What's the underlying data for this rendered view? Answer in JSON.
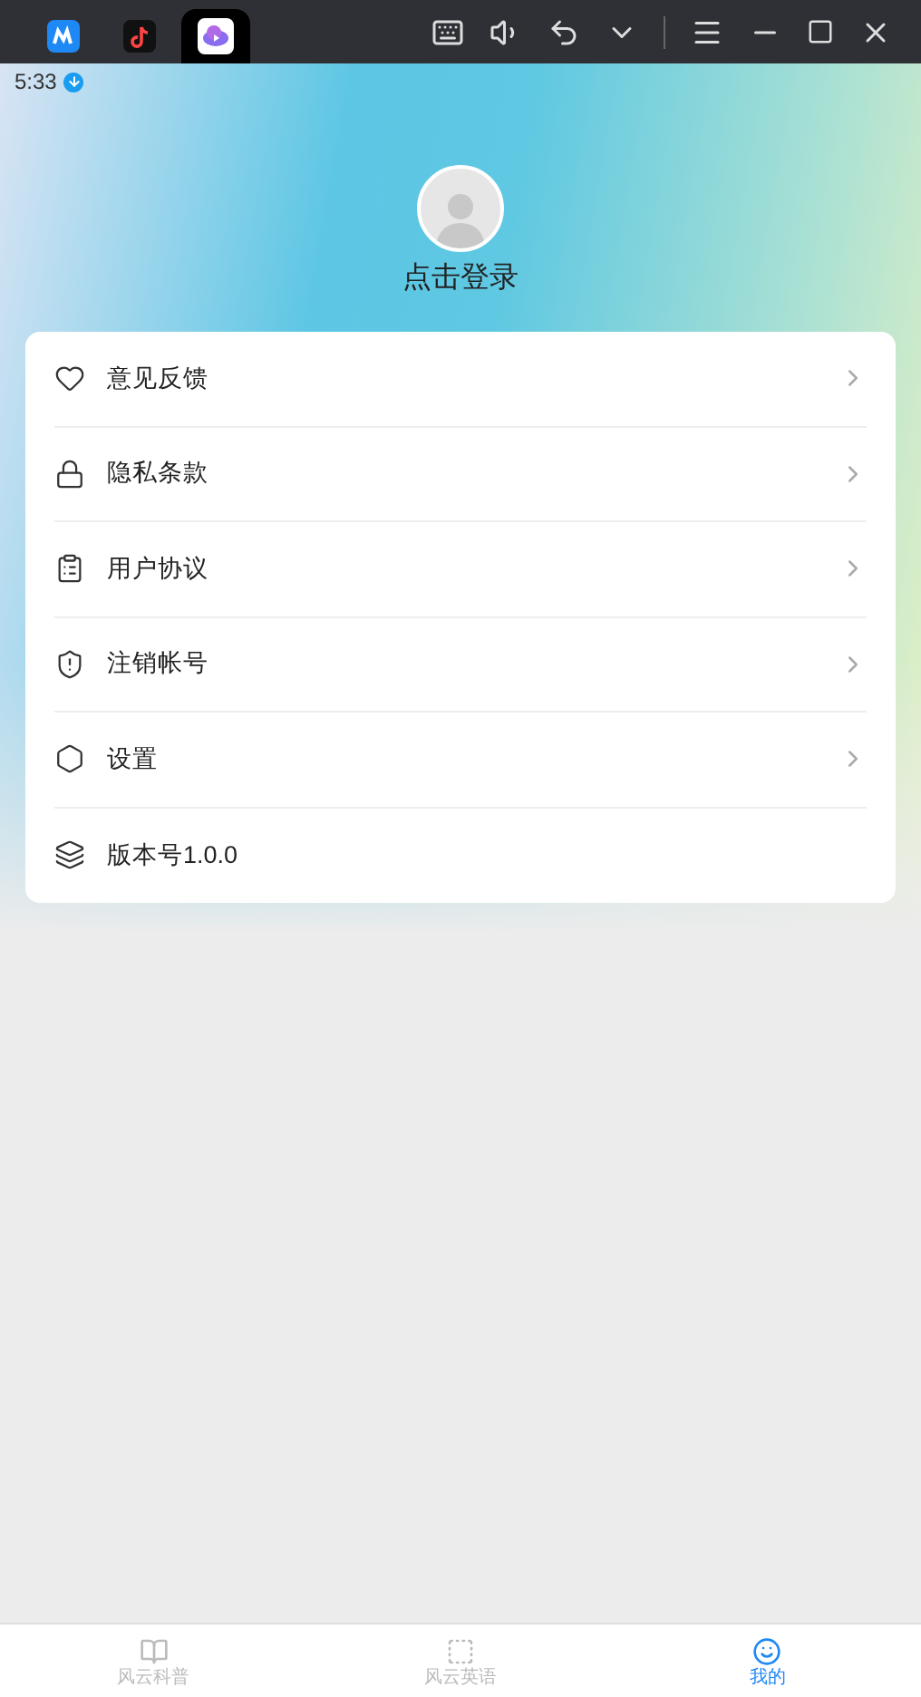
{
  "host_tabs": [
    {
      "kind": "m",
      "selected": false
    },
    {
      "kind": "note",
      "selected": false
    },
    {
      "kind": "cloud",
      "selected": true
    }
  ],
  "status_bar": {
    "time": "5:33"
  },
  "profile": {
    "login": "点击登录"
  },
  "menu": [
    {
      "label": "意见反馈",
      "kind": "link"
    },
    {
      "label": "隐私条款",
      "kind": "link"
    },
    {
      "label": "用户协议",
      "kind": "link"
    },
    {
      "label": "注销帐号",
      "kind": "link"
    },
    {
      "label": "设置",
      "kind": "link"
    },
    {
      "label": "版本号1.0.0",
      "kind": "info"
    }
  ],
  "tab_bar": [
    {
      "label": "风云科普",
      "selected": false
    },
    {
      "label": "风云英语",
      "selected": false
    },
    {
      "label": "我的",
      "selected": true
    }
  ]
}
